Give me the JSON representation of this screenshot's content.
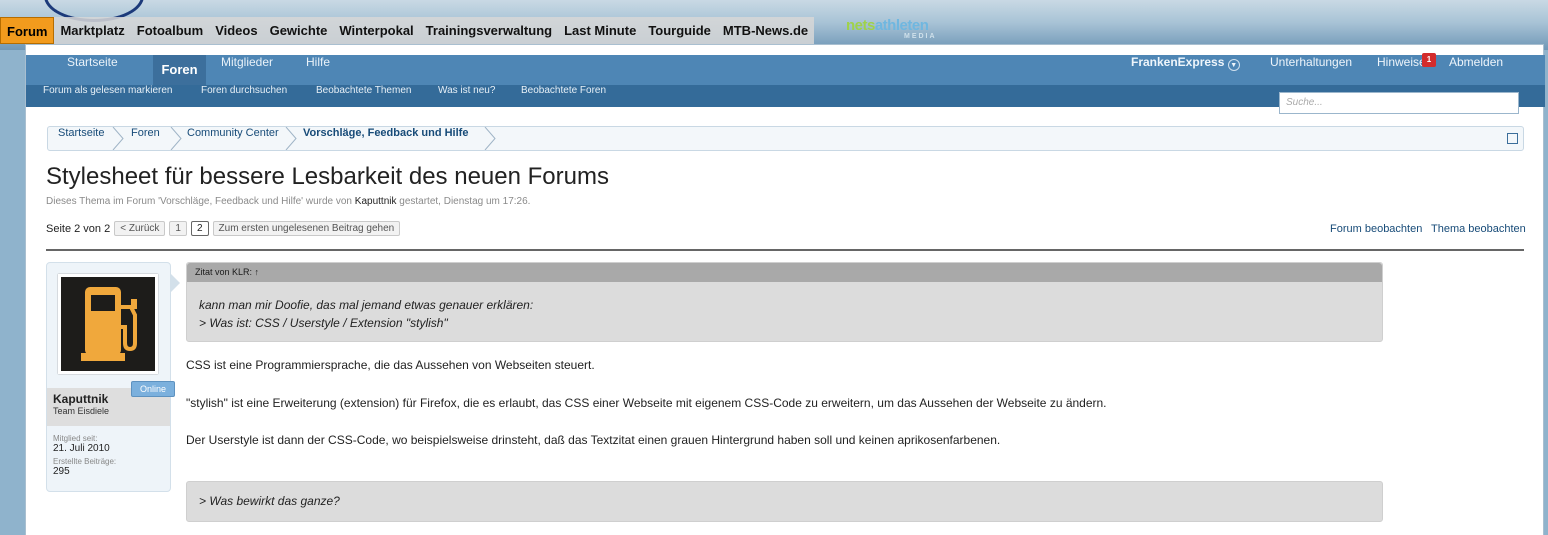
{
  "topnav": [
    "Forum",
    "Marktplatz",
    "Fotoalbum",
    "Videos",
    "Gewichte",
    "Winterpokal",
    "Trainingsverwaltung",
    "Last Minute",
    "Tourguide",
    "MTB-News.de"
  ],
  "brand": {
    "a": "nets",
    "b": "athleten",
    "c": "MEDIA"
  },
  "nav1": {
    "items": [
      "Startseite",
      "Foren",
      "Mitglieder",
      "Hilfe"
    ],
    "user": "FrankenExpress",
    "conversations": "Unterhaltungen",
    "alerts": "Hinweise",
    "alerts_count": "1",
    "logout": "Abmelden"
  },
  "nav2": [
    "Forum als gelesen markieren",
    "Foren durchsuchen",
    "Beobachtete Themen",
    "Was ist neu?",
    "Beobachtete Foren"
  ],
  "search_placeholder": "Suche...",
  "breadcrumb": [
    "Startseite",
    "Foren",
    "Community Center",
    "Vorschläge, Feedback und Hilfe"
  ],
  "thread": {
    "title": "Stylesheet für bessere Lesbarkeit des neuen Forums",
    "desc_pre": "Dieses Thema im Forum 'Vorschläge, Feedback und Hilfe' wurde von",
    "desc_user": "Kaputtnik",
    "desc_post": "gestartet, Dienstag um 17:26.",
    "page_label": "Seite 2 von 2",
    "prev": "< Zurück",
    "p1": "1",
    "p2": "2",
    "unread": "Zum ersten ungelesenen Beitrag gehen",
    "watch_forum": "Forum beobachten",
    "watch_thread": "Thema beobachten"
  },
  "post": {
    "username": "Kaputtnik",
    "usertitle": "Team Eisdiele",
    "online": "Online",
    "member_label": "Mitglied seit:",
    "member_since": "21. Juli 2010",
    "posts_label": "Erstellte Beiträge:",
    "posts": "295",
    "quote_head": "Zitat von KLR: ↑",
    "quote_l1": "kann man mir Doofie, das mal jemand etwas genauer erklären:",
    "quote_l2": "> Was ist: CSS / Userstyle / Extension \"stylish\"",
    "p1": "CSS ist eine Programmiersprache, die das Aussehen von Webseiten steuert.",
    "p2": "\"stylish\" ist eine Erweiterung (extension) für Firefox, die es erlaubt, das CSS einer Webseite mit eigenem CSS-Code zu erweitern, um das Aussehen der Webseite zu ändern.",
    "p3": "Der Userstyle ist dann der CSS-Code, wo beispielsweise drinsteht, daß das Textzitat einen grauen Hintergrund haben soll und keinen aprikosenfarbenen.",
    "quote2": "> Was bewirkt das ganze?"
  }
}
